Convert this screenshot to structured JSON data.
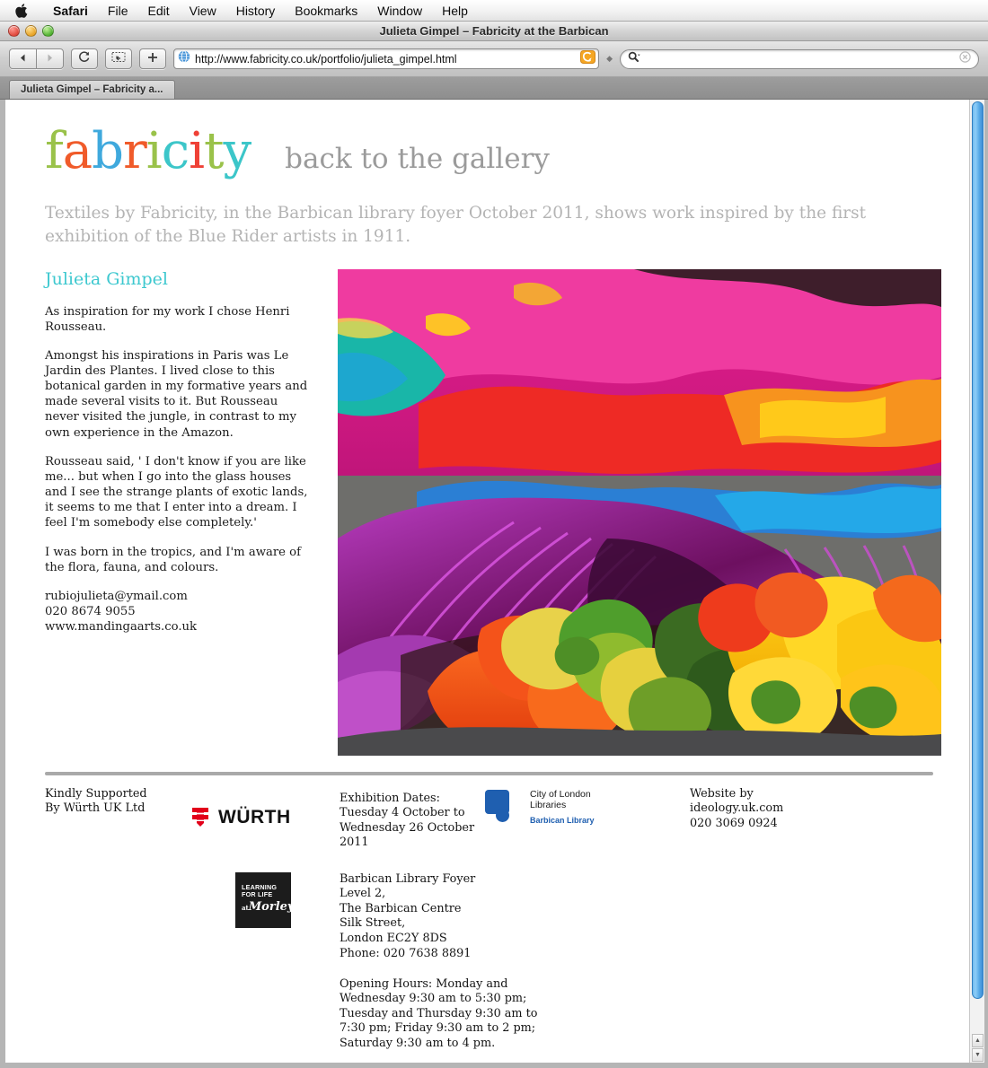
{
  "menubar": {
    "apple_icon": "apple-icon",
    "items": [
      {
        "label": "Safari",
        "bold": true
      },
      {
        "label": "File",
        "bold": false
      },
      {
        "label": "Edit",
        "bold": false
      },
      {
        "label": "View",
        "bold": false
      },
      {
        "label": "History",
        "bold": false
      },
      {
        "label": "Bookmarks",
        "bold": false
      },
      {
        "label": "Window",
        "bold": false
      },
      {
        "label": "Help",
        "bold": false
      }
    ]
  },
  "window": {
    "title": "Julieta Gimpel – Fabricity at the Barbican"
  },
  "toolbar": {
    "back_icon": "back-arrow-icon",
    "forward_icon": "forward-arrow-icon",
    "reload_icon": "reload-icon",
    "snapback_icon": "snapback-icon",
    "add_icon": "plus-icon",
    "site_icon": "globe-icon",
    "url": "http://www.fabricity.co.uk/portfolio/julieta_gimpel.html",
    "rss_icon": "rss-icon",
    "search_icon": "search-icon",
    "search_value": "",
    "search_placeholder": "",
    "search_clear_icon": "clear-icon"
  },
  "tabbar": {
    "tabs": [
      {
        "label": "Julieta Gimpel – Fabricity a..."
      }
    ]
  },
  "page": {
    "logo": {
      "letters": [
        {
          "ch": "f",
          "color": "#9ac24a"
        },
        {
          "ch": "a",
          "color": "#f05b2a"
        },
        {
          "ch": "b",
          "color": "#3fa9dd"
        },
        {
          "ch": "r",
          "color": "#f05b2a"
        },
        {
          "ch": "i",
          "color": "#9ac24a"
        },
        {
          "ch": "c",
          "color": "#3cc6c9"
        },
        {
          "ch": "i",
          "color": "#ef4136"
        },
        {
          "ch": "t",
          "color": "#9ac24a"
        },
        {
          "ch": "y",
          "color": "#3cc6c9"
        }
      ]
    },
    "gallery_link": "back to the gallery",
    "intro": "Textiles by Fabricity, in the Barbican library foyer October 2011, shows work inspired by the first exhibition of the Blue Rider artists in 1911.",
    "artist_name": "Julieta Gimpel",
    "paragraphs": [
      "As inspiration for my work I chose Henri Rousseau.",
      "Amongst his inspirations in Paris was Le Jardin des Plantes. I lived close to this botanical garden in my formative years and made several visits to it. But Rousseau never visited the jungle, in contrast to my own experience in the Amazon.",
      "Rousseau said, ' I don't know if you are like me... but when I go into the glass houses and I see the strange plants of exotic lands, it seems to me that I enter into a dream. I feel I'm somebody else completely.'",
      "I was born in the tropics, and I'm aware of the flora, fauna, and colours."
    ],
    "contact": {
      "email": "rubiojulieta@ymail.com",
      "phone": "020 8674 9055",
      "website": "www.mandingaarts.co.uk"
    },
    "photo_alt": "Brightly coloured crumpled dyed textiles in magenta, purple, red, orange, yellow, green and blue"
  },
  "footer": {
    "support_lines": [
      "Kindly Supported",
      "By Würth UK Ltd"
    ],
    "wurth_logo_text": "WÜRTH",
    "wurth_mark_icon": "wurth-mark-icon",
    "dates_lines": [
      "Exhibition Dates:",
      "Tuesday 4 October to",
      "Wednesday 26 October",
      "2011"
    ],
    "col_logo": {
      "line1": "City of London",
      "line2": "Libraries",
      "line3": "Barbican Library",
      "icon": "city-of-london-libraries-logo"
    },
    "website_lines": [
      "Website by",
      "ideology.uk.com",
      "020 3069 0924"
    ],
    "morley_logo": {
      "line1": "LEARNING",
      "line2": "FOR LIFE",
      "line3_small": "at",
      "line3": "Morley",
      "icon": "morley-college-logo"
    },
    "address_lines": [
      "Barbican Library Foyer",
      "Level 2,",
      "The Barbican Centre",
      "Silk Street,",
      "London EC2Y 8DS",
      "Phone: 020 7638 8891"
    ],
    "hours_lines": [
      "Opening Hours: Monday and",
      "Wednesday 9:30 am to 5:30 pm;",
      "Tuesday and Thursday 9:30 am to",
      "7:30 pm; Friday 9:30 am to 2 pm;",
      "Saturday 9:30 am to 4 pm."
    ]
  },
  "scrollbar": {
    "up_arrow_icon": "scroll-up-arrow-icon",
    "down_arrow_icon": "scroll-down-arrow-icon"
  }
}
